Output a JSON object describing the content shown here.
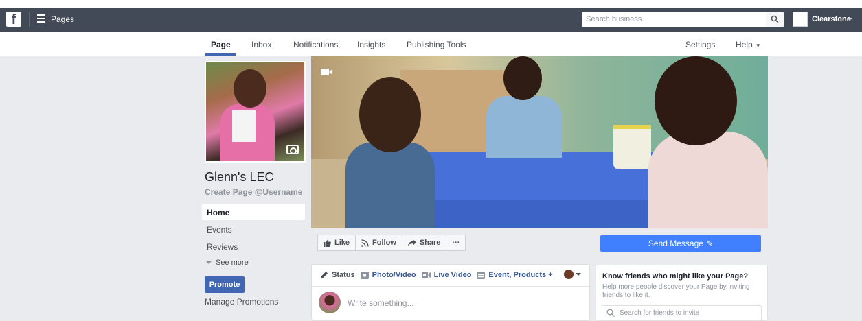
{
  "topbar": {
    "logo": "f",
    "pages_label": "Pages",
    "search_placeholder": "Search business",
    "user_name": "Clearstone"
  },
  "pagenav": {
    "tabs": [
      {
        "label": "Page",
        "active": true
      },
      {
        "label": "Inbox"
      },
      {
        "label": "Notifications"
      },
      {
        "label": "Insights"
      },
      {
        "label": "Publishing Tools"
      }
    ],
    "settings": "Settings",
    "help": "Help",
    "help_caret": "▼"
  },
  "left": {
    "page_name": "Glenn's LEC",
    "username_link": "Create Page @Username",
    "nav": [
      {
        "label": "Home",
        "active": true
      },
      {
        "label": "Events"
      },
      {
        "label": "Reviews"
      }
    ],
    "see_more": "See more",
    "promote": "Promote",
    "manage_promotions": "Manage Promotions"
  },
  "actions": {
    "like": "Like",
    "follow": "Follow",
    "share": "Share",
    "more": "···",
    "send_message": "Send Message",
    "pencil": "✎"
  },
  "composer": {
    "tabs": [
      "Status",
      "Photo/Video",
      "Live Video",
      "Event, Products +"
    ],
    "placeholder": "Write something..."
  },
  "invite": {
    "title": "Know friends who might like your Page?",
    "description": "Help more people discover your Page by inviting friends to like it.",
    "search_placeholder": "Search for friends to invite"
  },
  "colors": {
    "bluebar": "#414a56",
    "accent": "#4267b2",
    "send_button": "#4080ff"
  }
}
